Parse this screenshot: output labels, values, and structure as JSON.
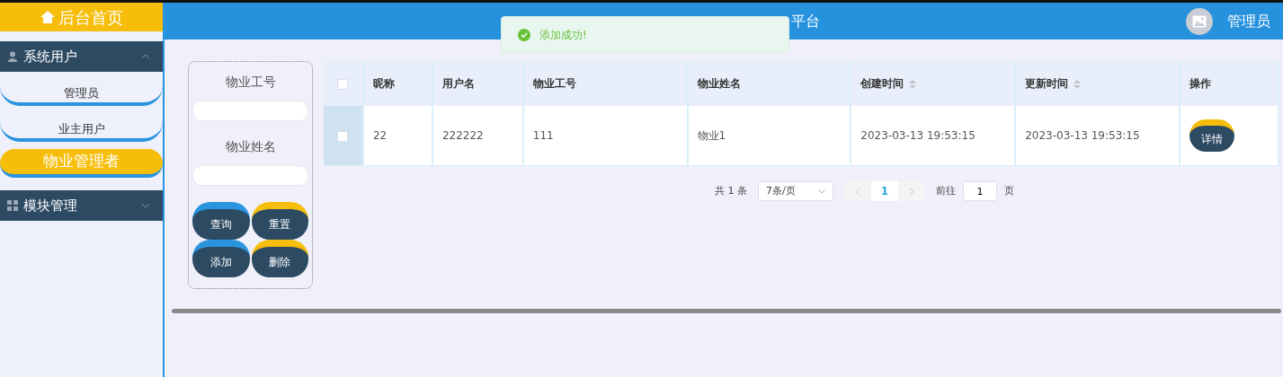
{
  "header": {
    "title": "平台",
    "username": "管理员"
  },
  "toast": {
    "message": "添加成功!"
  },
  "sidebar": {
    "home": "后台首页",
    "groups": [
      {
        "label": "系统用户",
        "expanded": true,
        "children": [
          {
            "label": "管理员",
            "selected": false
          },
          {
            "label": "业主用户",
            "selected": false
          },
          {
            "label": "物业管理者",
            "selected": true
          }
        ]
      },
      {
        "label": "模块管理",
        "expanded": false
      }
    ]
  },
  "search": {
    "fields": [
      {
        "label": "物业工号"
      },
      {
        "label": "物业姓名"
      }
    ],
    "buttons": [
      {
        "label": "查询",
        "color": "#2a94de"
      },
      {
        "label": "重置",
        "color": "#f6be0a"
      },
      {
        "label": "添加",
        "color": "#2a94de"
      },
      {
        "label": "删除",
        "color": "#f6be0a"
      }
    ]
  },
  "table": {
    "select_all_checked": false,
    "columns": [
      {
        "label": "昵称",
        "sortable": false
      },
      {
        "label": "用户名",
        "sortable": false
      },
      {
        "label": "物业工号",
        "sortable": false
      },
      {
        "label": "物业姓名",
        "sortable": false
      },
      {
        "label": "创建时间",
        "sortable": true
      },
      {
        "label": "更新时间",
        "sortable": true
      },
      {
        "label": "操作",
        "sortable": false
      }
    ],
    "rows": [
      {
        "checked": false,
        "cells": [
          "22",
          "222222",
          "111",
          "物业1",
          "2023-03-13 19:53:15",
          "2023-03-13 19:53:15"
        ],
        "action": "详情"
      }
    ]
  },
  "pagination": {
    "total": "共 1 条",
    "page_size": "7条/页",
    "pages": [
      {
        "label": "1",
        "selected": true
      }
    ],
    "goto_label": "前往",
    "goto_value": "1",
    "goto_suffix": "页"
  }
}
